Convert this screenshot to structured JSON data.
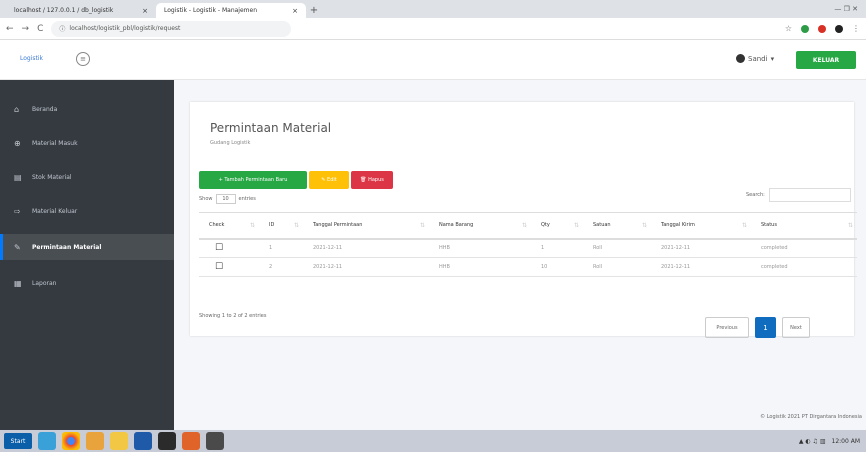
{
  "browser": {
    "tabs": [
      {
        "label": "localhost / 127.0.0.1 / db_logistik",
        "close": "×"
      },
      {
        "label": "Logistik - Logistik - Manajemen",
        "close": "×"
      }
    ],
    "new_tab": "+",
    "window_controls": "— ❐ ✕",
    "url": "localhost/logistik_pbl/logistik/request",
    "nav_back": "←",
    "nav_forward": "→",
    "nav_reload": "C",
    "lock": "ⓘ"
  },
  "header": {
    "brand": "Logistik",
    "menu_icon": "≡",
    "user": "Sandi",
    "logout_label": "KELUAR"
  },
  "sidebar": {
    "items": [
      {
        "icon": "⌂",
        "label": "Beranda"
      },
      {
        "icon": "⊕",
        "label": "Material Masuk"
      },
      {
        "icon": "▤",
        "label": "Stok Material"
      },
      {
        "icon": "⇨",
        "label": "Material Keluar"
      },
      {
        "icon": "✎",
        "label": "Permintaan Material"
      },
      {
        "icon": "▦",
        "label": "Laporan"
      }
    ]
  },
  "main": {
    "title": "Permintaan Material",
    "subtitle": "Gudang Logistik",
    "buttons": {
      "add": "+ Tambah Permintaan Baru",
      "edit": "✎ Edit",
      "delete": "🗑 Hapus"
    },
    "show_label": "Show",
    "show_value": "10",
    "entries_label": "entries",
    "search_label": "Search:",
    "columns": [
      "Check",
      "ID",
      "Tanggal Permintaan",
      "Nama Barang",
      "Qty",
      "Satuan",
      "Tanggal Kirim",
      "Status"
    ],
    "rows": [
      {
        "check": "☐",
        "id": "1",
        "tanggal": "2021-12-11",
        "nama": "HHB",
        "qty": "1",
        "satuan": "Roll",
        "kirim": "2021-12-11",
        "status": "completed"
      },
      {
        "check": "☐",
        "id": "2",
        "tanggal": "2021-12-11",
        "nama": "HHB",
        "qty": "10",
        "satuan": "Roll",
        "kirim": "2021-12-11",
        "status": "completed"
      }
    ],
    "info": "Showing 1 to 2 of 2 entries",
    "pagination": {
      "prev": "Previous",
      "current": "1",
      "next": "Next"
    },
    "footer": "© Logistik 2021 PT Dirgantara Indonesia"
  },
  "taskbar": {
    "start": "Start",
    "tray": "▲ ◐ ♫ ▥",
    "clock": "12:00 AM"
  }
}
